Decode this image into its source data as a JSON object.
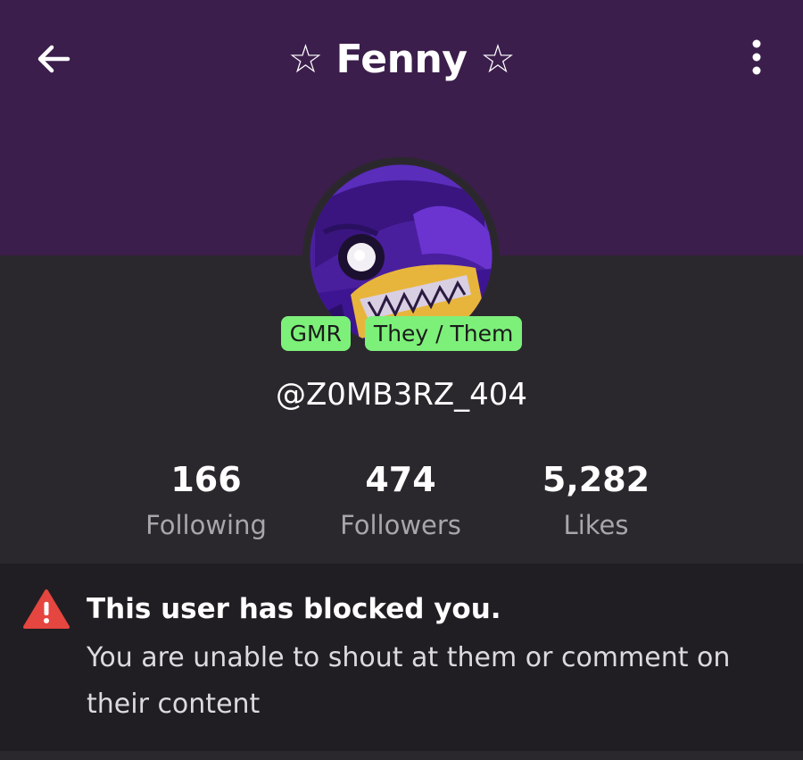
{
  "header": {
    "title": "☆ Fenny ☆",
    "back_icon": "arrow-left-icon",
    "more_icon": "more-vertical-icon"
  },
  "profile": {
    "badges": [
      "GMR",
      "They / Them"
    ],
    "handle": "@Z0MB3RZ_404"
  },
  "stats": [
    {
      "value": "166",
      "label": "Following"
    },
    {
      "value": "474",
      "label": "Followers"
    },
    {
      "value": "5,282",
      "label": "Likes"
    }
  ],
  "notice": {
    "icon": "warning-icon",
    "title": "This user has blocked you.",
    "body": "You are unable to shout at them or comment on their content"
  },
  "colors": {
    "banner": "#3b1e4b",
    "background": "#2b282d",
    "notice_background": "#211e23",
    "badge": "#7df07a",
    "warning": "#e5463f"
  }
}
